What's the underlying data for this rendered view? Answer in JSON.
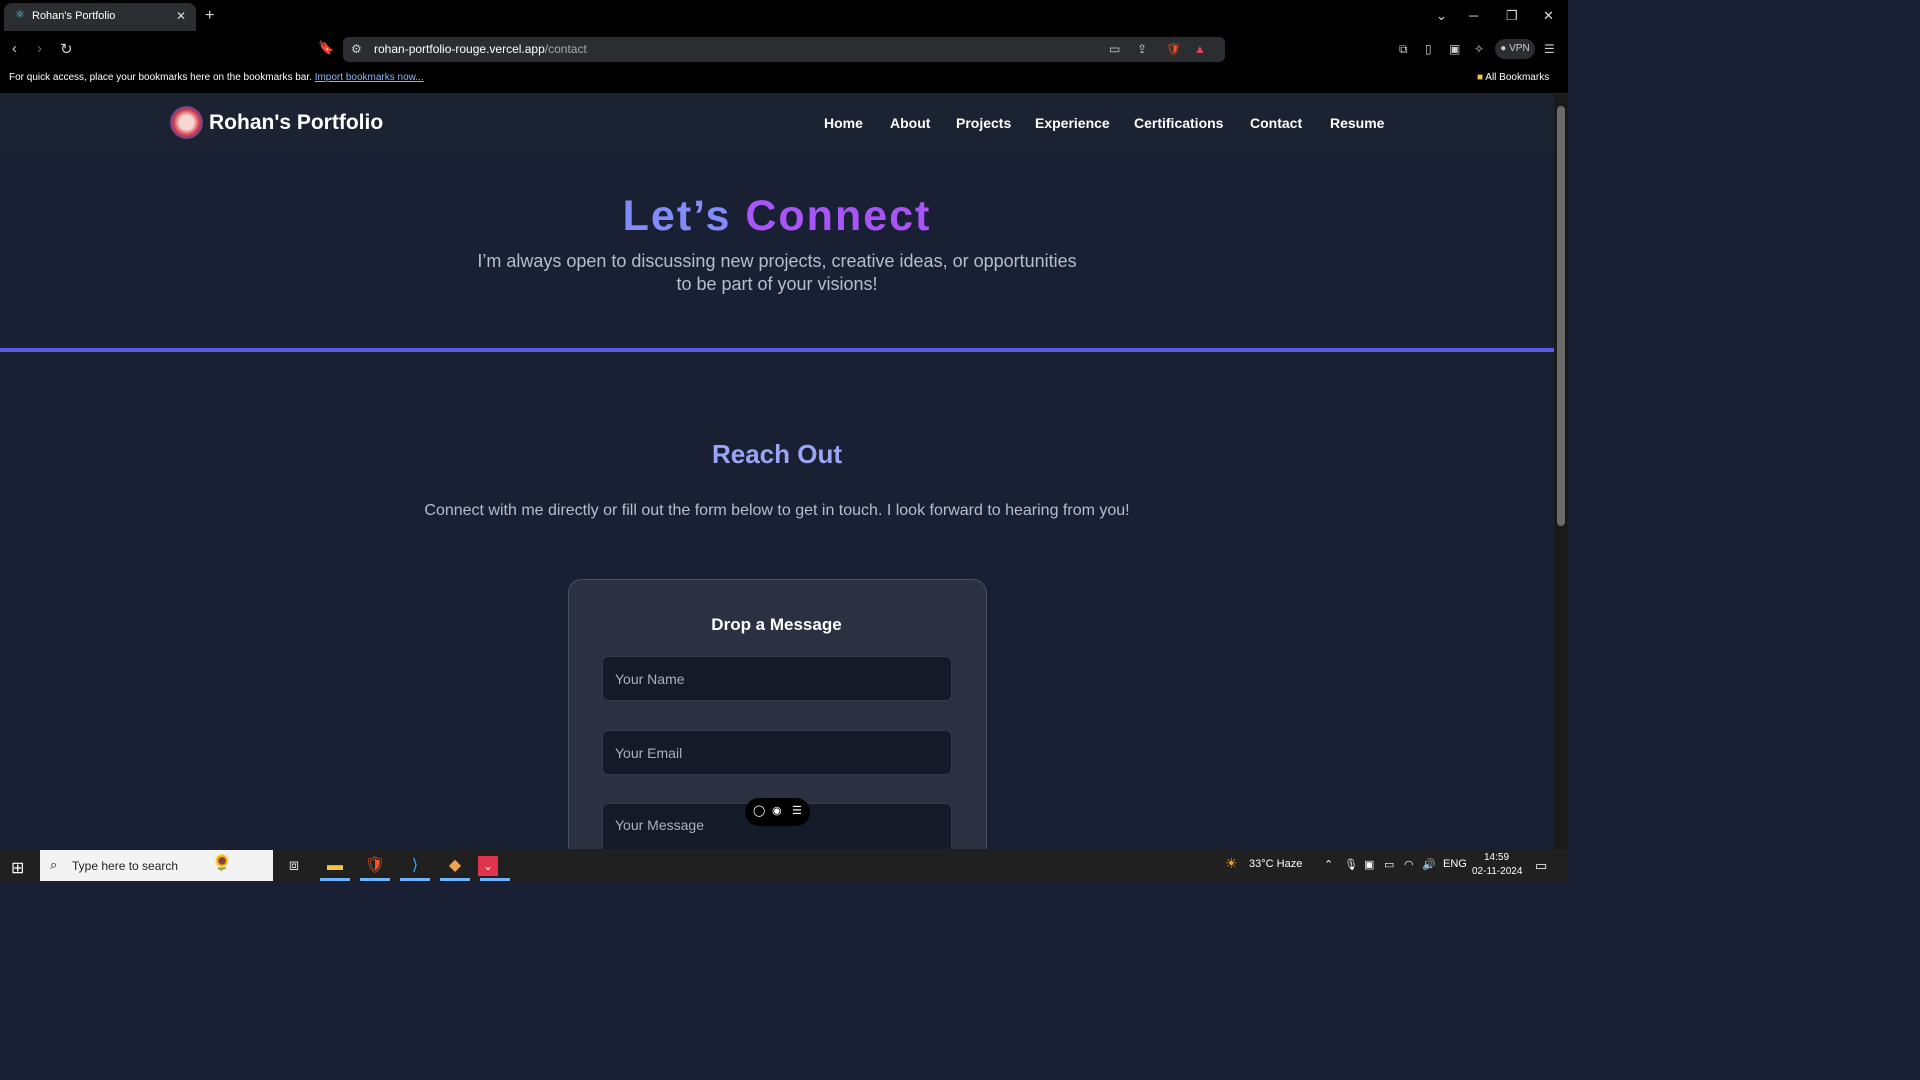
{
  "browser": {
    "tab_title": "Rohan's Portfolio",
    "url_host": "rohan-portfolio-rouge.vercel.app",
    "url_path": "/contact",
    "vpn_label": "VPN",
    "bookmarks_prompt": "For quick access, place your bookmarks here on the bookmarks bar.",
    "bookmarks_link": "Import bookmarks now...",
    "all_bookmarks": "All Bookmarks"
  },
  "site": {
    "brand": "Rohan's Portfolio",
    "nav": [
      "Home",
      "About",
      "Projects",
      "Experience",
      "Certifications",
      "Contact",
      "Resume"
    ],
    "hero_title_1": "Let’s",
    "hero_title_2": "Connect",
    "hero_subtitle": "I’m always open to discussing new projects, creative ideas, or opportunities to be part of your visions!",
    "reach_title": "Reach Out",
    "reach_subtitle": "Connect with me directly or fill out the form below to get in touch. I look forward to hearing from you!",
    "form": {
      "title": "Drop a Message",
      "name_placeholder": "Your Name",
      "email_placeholder": "Your Email",
      "message_placeholder": "Your Message"
    }
  },
  "taskbar": {
    "search_placeholder": "Type here to search",
    "weather": "33°C  Haze",
    "language": "ENG",
    "time": "14:59",
    "date": "02-11-2024"
  },
  "colors": {
    "accent_indigo": "#818cf8",
    "accent_purple": "#a855f7",
    "divider": "#5b5ce6",
    "background": "#1a2033"
  }
}
